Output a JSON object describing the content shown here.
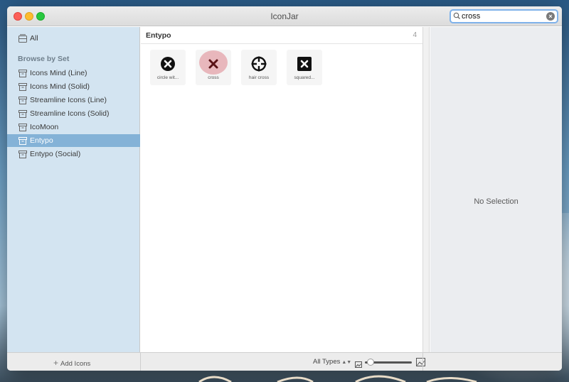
{
  "window": {
    "title": "IconJar"
  },
  "search": {
    "value": "cross",
    "placeholder": "Search"
  },
  "sidebar": {
    "all_label": "All",
    "heading": "Browse by Set",
    "items": [
      {
        "label": "Icons Mind (Line)"
      },
      {
        "label": "Icons Mind (Solid)"
      },
      {
        "label": "Streamline Icons (Line)"
      },
      {
        "label": "Streamline Icons (Solid)"
      },
      {
        "label": "IcoMoon"
      },
      {
        "label": "Entypo",
        "selected": true
      },
      {
        "label": "Entypo (Social)"
      }
    ]
  },
  "center": {
    "title": "Entypo",
    "count": "4",
    "icons": [
      {
        "name": "circle wit...",
        "icon": "circled-cross-icon"
      },
      {
        "name": "cross",
        "icon": "cross-icon",
        "selected": true
      },
      {
        "name": "hair cross",
        "icon": "hair-cross-icon"
      },
      {
        "name": "squared...",
        "icon": "squared-cross-icon"
      }
    ]
  },
  "inspector": {
    "empty_label": "No Selection"
  },
  "bottombar": {
    "add_icons_label": "Add Icons",
    "types_filter": "All Types",
    "zoom_level": 0.05
  },
  "colors": {
    "sidebar_bg": "#d3e4f1",
    "selection": "#84b2d7",
    "icon_selection_halo": "#e8b7bc",
    "search_focus": "#7fb2ea"
  }
}
